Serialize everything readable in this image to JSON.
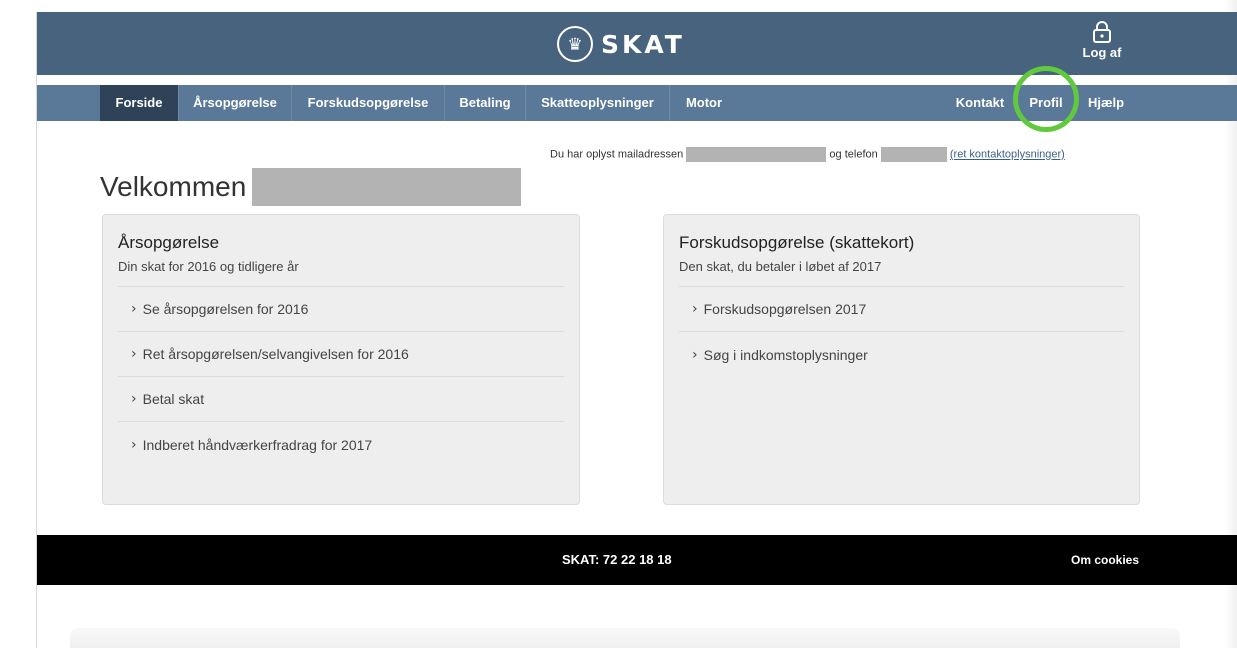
{
  "header": {
    "logo_text": "SKAT",
    "logo_icon": "crown-seal-icon",
    "logout_label": "Log af",
    "logout_icon": "padlock-icon"
  },
  "nav": {
    "items": [
      {
        "label": "Forside",
        "active": true
      },
      {
        "label": "Årsopgørelse"
      },
      {
        "label": "Forskudsopgørelse"
      },
      {
        "label": "Betaling"
      },
      {
        "label": "Skatteoplysninger"
      },
      {
        "label": "Motor"
      }
    ],
    "right_items": [
      {
        "label": "Kontakt"
      },
      {
        "label": "Profil"
      },
      {
        "label": "Hjælp"
      }
    ],
    "highlight_color": "#61c93e"
  },
  "contact": {
    "prefix": "Du har oplyst mailadressen",
    "middle": "og telefon",
    "link": "(ret kontaktoplysninger)"
  },
  "welcome": {
    "text": "Velkommen"
  },
  "panels": [
    {
      "title": "Årsopgørelse",
      "subtitle": "Din skat for 2016 og tidligere år",
      "links": [
        "Se årsopgørelsen for 2016",
        "Ret årsopgørelsen/selvangivelsen for 2016",
        "Betal skat",
        "Indberet håndværkerfradrag for 2017"
      ]
    },
    {
      "title": "Forskudsopgørelse (skattekort)",
      "subtitle": "Den skat, du betaler i løbet af 2017",
      "links": [
        "Forskudsopgørelsen 2017",
        "Søg i indkomstoplysninger"
      ]
    }
  ],
  "footer": {
    "phone": "SKAT: 72 22 18 18",
    "cookies": "Om cookies"
  },
  "colors": {
    "topbar": "#48637d",
    "navbar": "#5a7897",
    "nav_active": "#2e4258",
    "panel_bg": "#eeeeee",
    "footer": "#000000"
  }
}
